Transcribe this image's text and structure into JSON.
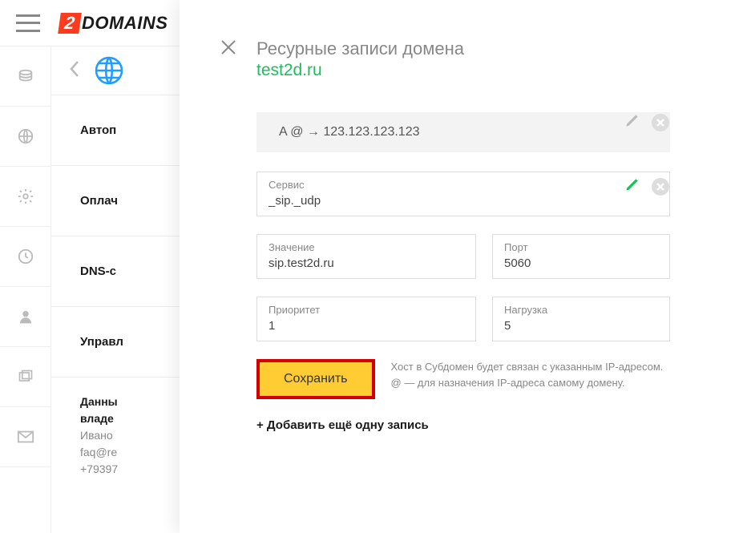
{
  "logo": {
    "badge": "2",
    "text": "DOMAINS"
  },
  "sidebar_icons": [
    "coins",
    "globe",
    "gear",
    "clock",
    "user",
    "windows",
    "mail"
  ],
  "secondary": {
    "menu": [
      "Автоп",
      "Оплач",
      "DNS-с",
      "Управл"
    ],
    "details_title1": "Данны",
    "details_title2": "владе",
    "name": "Ивано",
    "email": "faq@re",
    "phone": "+79397"
  },
  "modal": {
    "title": "Ресурные записи домена",
    "domain": "test2d.ru",
    "record_summary": "A @ → 123.123.123.123",
    "fields": {
      "service_label": "Сервис",
      "service_value": "_sip._udp",
      "value_label": "Значение",
      "value_value": "sip.test2d.ru",
      "port_label": "Порт",
      "port_value": "5060",
      "priority_label": "Приоритет",
      "priority_value": "1",
      "weight_label": "Нагрузка",
      "weight_value": "5"
    },
    "save_label": "Сохранить",
    "hint": "Хост в Субдомен будет связан с указанным IP-адресом. @ — для назначения IP-адреса самому домену.",
    "add_label": "+ Добавить ещё одну запись"
  }
}
